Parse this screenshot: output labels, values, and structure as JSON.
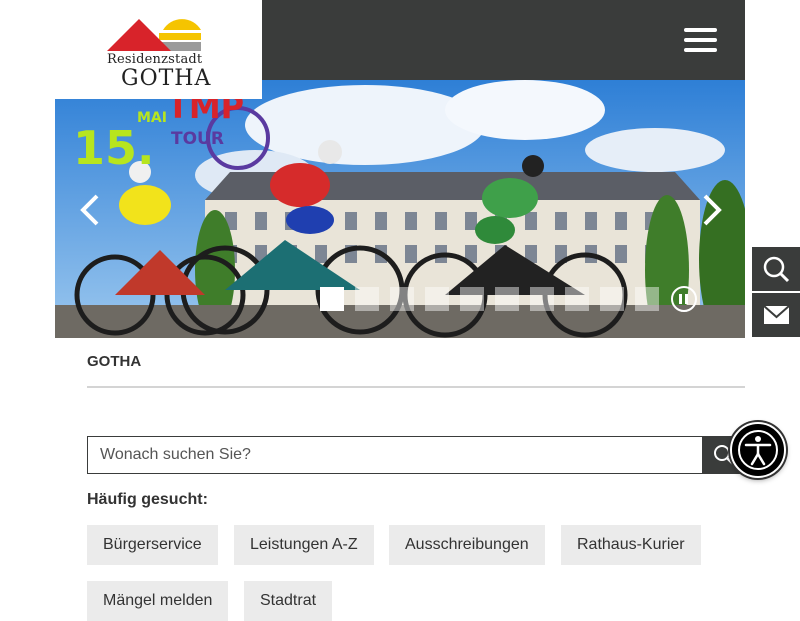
{
  "header": {
    "logo": {
      "line1": "Residenzstadt",
      "line2": "GOTHA"
    },
    "menu_icon": "hamburger-icon"
  },
  "hero": {
    "event_badge": {
      "day": "15.",
      "month": "MAI",
      "brand": "TMP",
      "tour": "TOUR"
    },
    "prev_icon": "chevron-left-icon",
    "next_icon": "chevron-right-icon",
    "slide_count": 10,
    "active_slide": 1,
    "pause_icon": "pause-icon"
  },
  "side_tools": [
    {
      "icon": "search-icon"
    },
    {
      "icon": "mail-icon"
    }
  ],
  "breadcrumb": {
    "current": "GOTHA"
  },
  "search": {
    "placeholder": "Wonach suchen Sie?",
    "value": "",
    "button_icon": "search-icon"
  },
  "frequent": {
    "label": "Häufig gesucht:",
    "tags": [
      "Bürgerservice",
      "Leistungen A-Z",
      "Ausschreibungen",
      "Rathaus-Kurier",
      "Mängel melden",
      "Stadtrat"
    ]
  },
  "accessibility": {
    "icon": "accessibility-icon"
  },
  "colors": {
    "dark": "#3a3c3b",
    "logo_red": "#d8232a",
    "logo_yellow": "#f5c400",
    "logo_gray": "#9a9a9a",
    "badge_green": "#b7e51e",
    "badge_purple": "#5a3aa0",
    "tag_bg": "#ebebeb"
  }
}
